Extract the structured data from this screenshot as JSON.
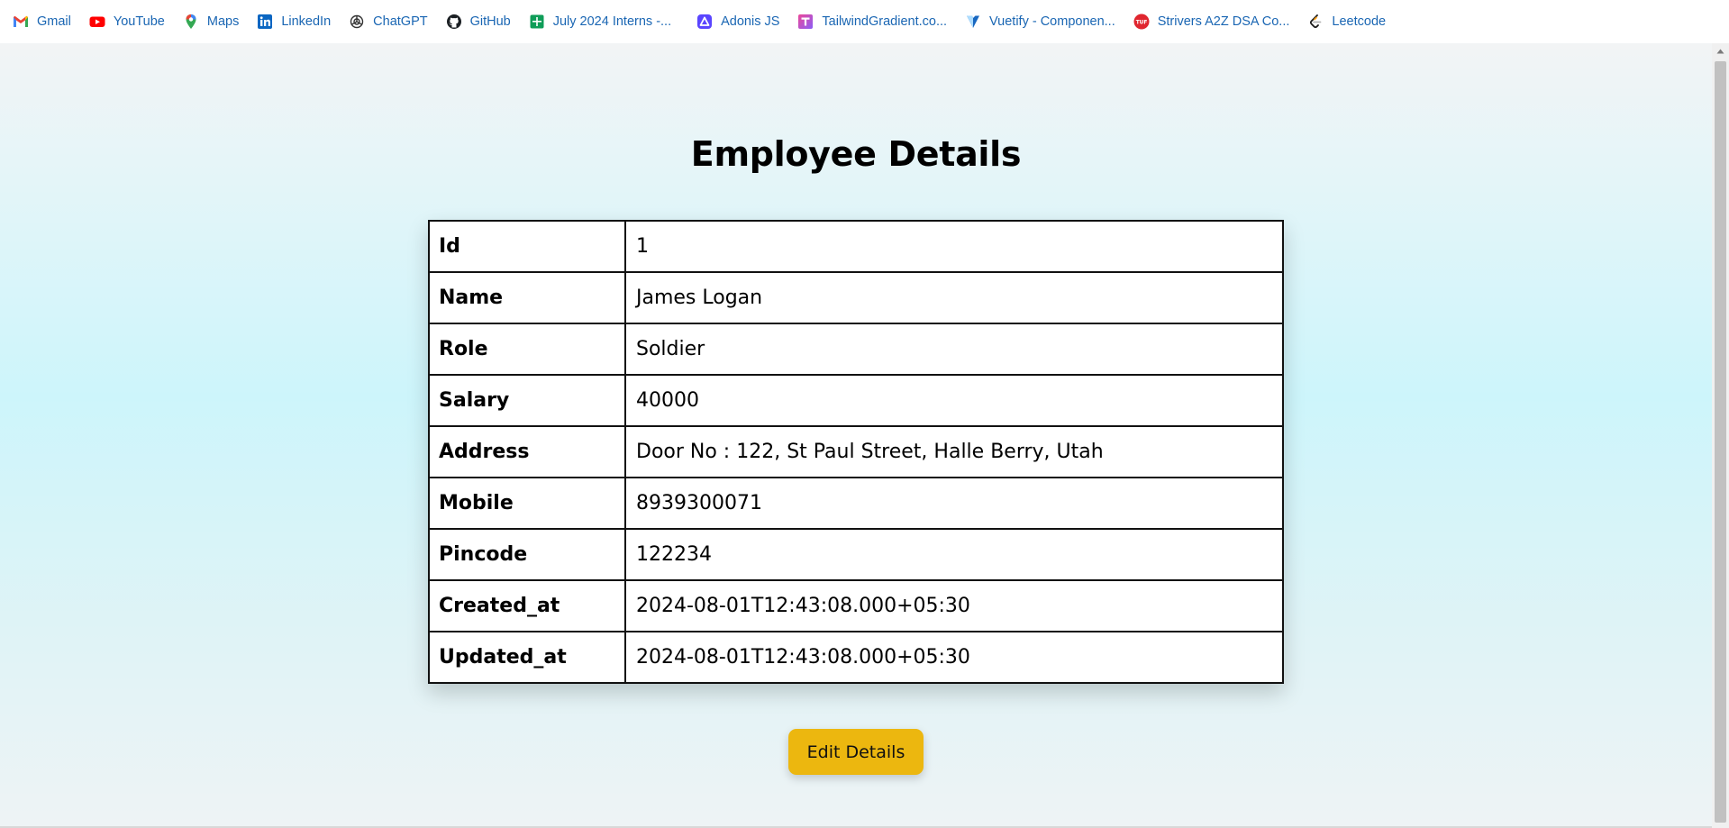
{
  "bookmarks": [
    {
      "label": "Gmail",
      "icon": "gmail-icon"
    },
    {
      "label": "YouTube",
      "icon": "youtube-icon"
    },
    {
      "label": "Maps",
      "icon": "maps-icon"
    },
    {
      "label": "LinkedIn",
      "icon": "linkedin-icon"
    },
    {
      "label": "ChatGPT",
      "icon": "chatgpt-icon"
    },
    {
      "label": "GitHub",
      "icon": "github-icon"
    },
    {
      "label": "July 2024 Interns -...",
      "icon": "sheets-icon"
    },
    {
      "label": "Adonis JS",
      "icon": "adonis-icon"
    },
    {
      "label": "TailwindGradient.co...",
      "icon": "tailwind-gradient-icon"
    },
    {
      "label": "Vuetify - Componen...",
      "icon": "vuetify-icon"
    },
    {
      "label": "Strivers A2Z DSA Co...",
      "icon": "tuf-icon"
    },
    {
      "label": "Leetcode",
      "icon": "leetcode-icon"
    }
  ],
  "page": {
    "title": "Employee Details"
  },
  "employee": {
    "rows": [
      {
        "label": "Id",
        "value": "1"
      },
      {
        "label": "Name",
        "value": "James Logan"
      },
      {
        "label": "Role",
        "value": "Soldier"
      },
      {
        "label": "Salary",
        "value": "40000"
      },
      {
        "label": "Address",
        "value": "Door No : 122, St Paul Street, Halle Berry, Utah"
      },
      {
        "label": "Mobile",
        "value": "8939300071"
      },
      {
        "label": "Pincode",
        "value": "122234"
      },
      {
        "label": "Created_at",
        "value": "2024-08-01T12:43:08.000+05:30"
      },
      {
        "label": "Updated_at",
        "value": "2024-08-01T12:43:08.000+05:30"
      }
    ]
  },
  "actions": {
    "edit_label": "Edit Details"
  },
  "colors": {
    "accent_button": "#ecb70f",
    "bookmark_text": "#1a66b3"
  }
}
